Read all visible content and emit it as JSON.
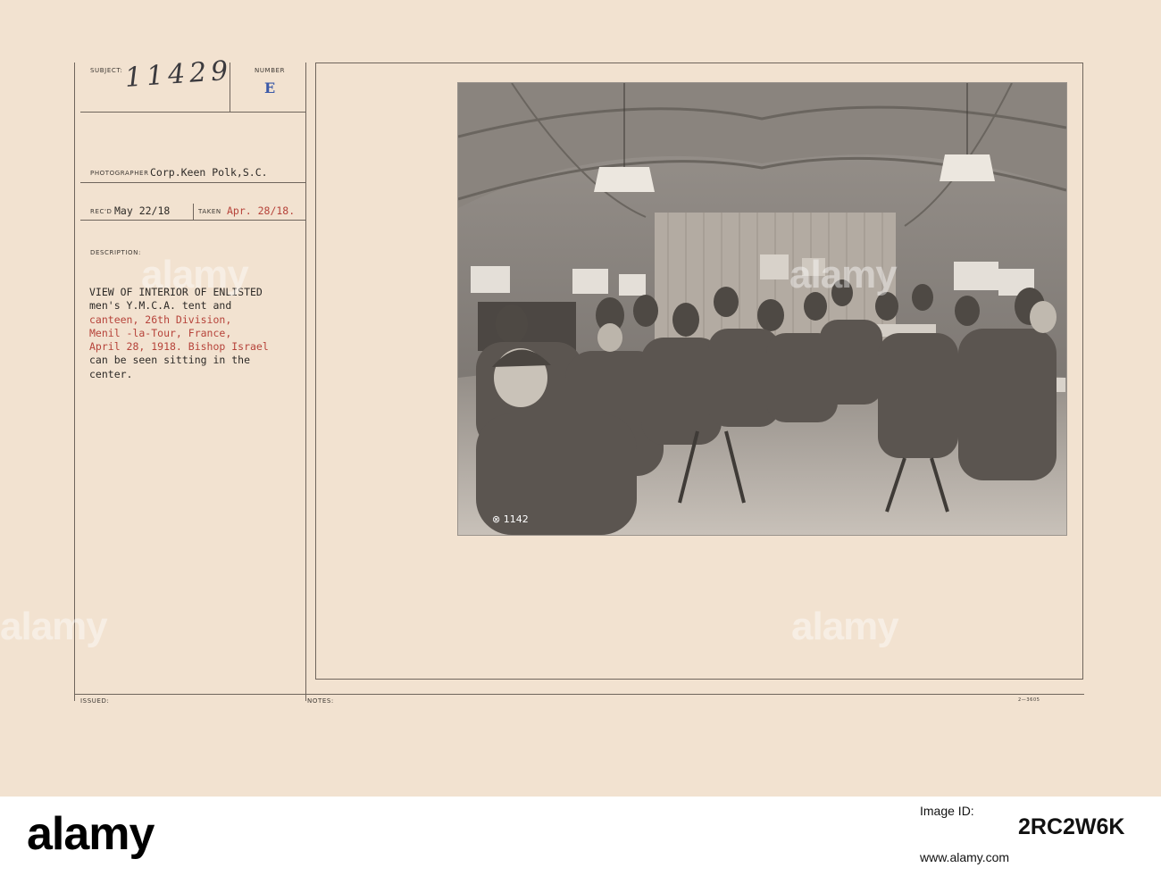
{
  "card": {
    "subject_label": "SUBJECT:",
    "subject_value": "11429",
    "number_label": "NUMBER",
    "number_value": "E",
    "photographer_label": "PHOTOGRAPHER",
    "photographer_value": "Corp.Keen Polk,S.C.",
    "recd_label": "REC'D",
    "recd_value": "May 22/18",
    "taken_label": "TAKEN",
    "taken_value": "Apr. 28/18.",
    "description_label": "DESCRIPTION:",
    "description_lines": [
      {
        "text": "VIEW OF INTERIOR OF ENLISTED",
        "color": "#2d2a27"
      },
      {
        "text": "men's Y.M.C.A. tent and",
        "color": "#2d2a27"
      },
      {
        "text": "canteen, 26th Division,",
        "color": "#b6433a"
      },
      {
        "text": "Menil -la-Tour, France,",
        "color": "#b6433a"
      },
      {
        "text": "April 28, 1918. Bishop Israel",
        "color": "#b6433a"
      },
      {
        "text": "can be seen sitting in the",
        "color": "#2d2a27"
      },
      {
        "text": "center.",
        "color": "#2d2a27"
      }
    ],
    "issued_label": "ISSUED:",
    "notes_label": "NOTES:",
    "form_code": "2—3605",
    "photo_mark": "⊗ 1142"
  },
  "watermarks": [
    "alamy",
    "alamy",
    "alamy",
    "alamy"
  ],
  "footer": {
    "logo": "alamy",
    "image_id_label": "Image ID:",
    "image_id": "2RC2W6K",
    "site": "www.alamy.com"
  },
  "colors": {
    "card_bg": "#f2e2d0",
    "typed_red": "#b6433a",
    "stamp_blue": "#3b59a8",
    "rule": "#6f655c"
  }
}
